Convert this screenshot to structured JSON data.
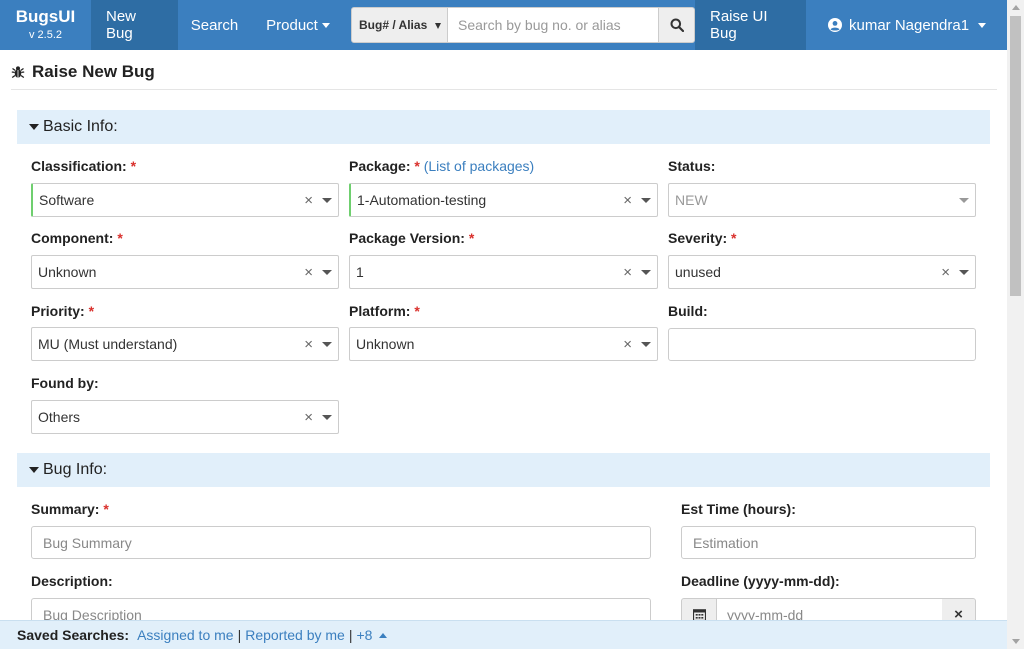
{
  "nav": {
    "brand": "BugsUI",
    "version": "v 2.5.2",
    "new_bug": "New Bug",
    "search": "Search",
    "product": "Product",
    "search_type": "Bug# / Alias",
    "search_placeholder": "Search by bug no. or alias",
    "raise_ui_bug": "Raise UI Bug",
    "user": "kumar Nagendra1"
  },
  "page": {
    "title": "Raise New Bug"
  },
  "basic_info": {
    "heading": "Basic Info:",
    "classification": {
      "label": "Classification:",
      "req": "*",
      "value": "Software"
    },
    "package": {
      "label": "Package:",
      "req": "*",
      "link": "(List of packages)",
      "value": "1-Automation-testing"
    },
    "status": {
      "label": "Status:",
      "value": "NEW"
    },
    "component": {
      "label": "Component:",
      "req": "*",
      "value": "Unknown"
    },
    "package_version": {
      "label": "Package Version:",
      "req": "*",
      "value": "1"
    },
    "severity": {
      "label": "Severity:",
      "req": "*",
      "value": "unused"
    },
    "priority": {
      "label": "Priority:",
      "req": "*",
      "value": "MU (Must understand)"
    },
    "platform": {
      "label": "Platform:",
      "req": "*",
      "value": "Unknown"
    },
    "build": {
      "label": "Build:",
      "value": ""
    },
    "found_by": {
      "label": "Found by:",
      "value": "Others"
    }
  },
  "bug_info": {
    "heading": "Bug Info:",
    "summary": {
      "label": "Summary:",
      "req": "*",
      "placeholder": "Bug Summary"
    },
    "est_time": {
      "label": "Est Time (hours):",
      "placeholder": "Estimation"
    },
    "description": {
      "label": "Description:",
      "placeholder": "Bug Description"
    },
    "deadline": {
      "label": "Deadline (yyyy-mm-dd):",
      "placeholder": "yyyy-mm-dd"
    }
  },
  "footer": {
    "label": "Saved Searches:",
    "assigned": "Assigned to me",
    "sep": "|",
    "reported": "Reported by me",
    "more": "+8"
  },
  "colors": {
    "navbar": "#3b7fbf",
    "section": "#e1effa",
    "required": "#d9302c",
    "link": "#3b7fbf"
  },
  "clear_glyph": "×"
}
